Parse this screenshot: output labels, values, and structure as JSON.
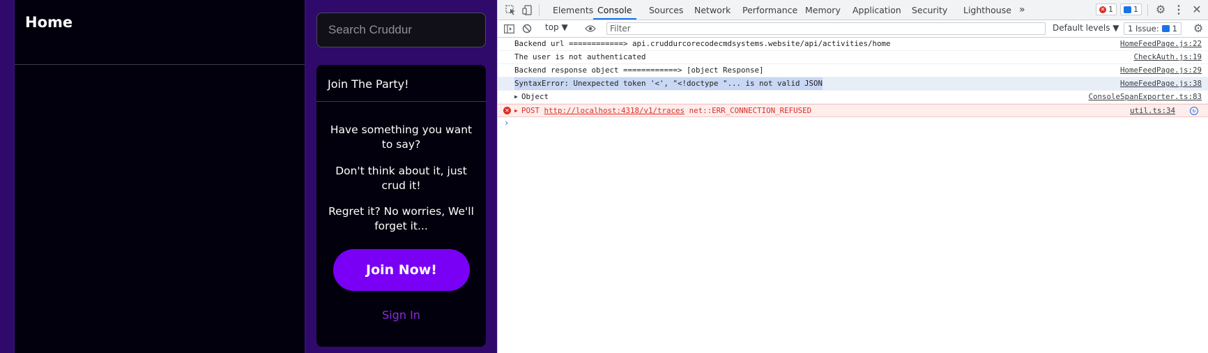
{
  "app": {
    "feed_title": "Home",
    "search_placeholder": "Search Cruddur",
    "join": {
      "title": "Join The Party!",
      "lines": [
        "Have something you want to say?",
        "Don't think about it, just crud it!",
        "Regret it? No worries, We'll forget it..."
      ],
      "join_button": "Join Now!",
      "sign_in": "Sign In"
    },
    "colors": {
      "background": "#2f0a6b",
      "panel": "#02000c",
      "accent": "#7a00f5"
    }
  },
  "devtools": {
    "tabs": [
      "Elements",
      "Console",
      "Sources",
      "Network",
      "Performance",
      "Memory",
      "Application",
      "Security",
      "Lighthouse"
    ],
    "active_tab": "Console",
    "more_tabs": "»",
    "error_count": "1",
    "message_count": "1",
    "toolbar": {
      "context": "top",
      "filter_placeholder": "Filter",
      "levels": "Default levels",
      "issues_label": "1 Issue:",
      "issues_count": "1"
    },
    "logs": [
      {
        "message": "Backend url ============> api.cruddurcorecodecmdsystems.website/api/activities/home",
        "source": "HomeFeedPage.js:22"
      },
      {
        "message": "The user is not authenticated",
        "source": "CheckAuth.js:19"
      },
      {
        "message": "Backend response object ============> [object Response]",
        "source": "HomeFeedPage.js:29"
      },
      {
        "message": "SyntaxError: Unexpected token '<', \"<!doctype \"... is not valid JSON",
        "source": "HomeFeedPage.js:38"
      },
      {
        "message": "Object",
        "source": "ConsoleSpanExporter.ts:83"
      },
      {
        "method": "POST",
        "url": "http://localhost:4318/v1/traces",
        "error": "net::ERR_CONNECTION_REFUSED",
        "source": "util.ts:34"
      }
    ],
    "prompt": "›"
  }
}
